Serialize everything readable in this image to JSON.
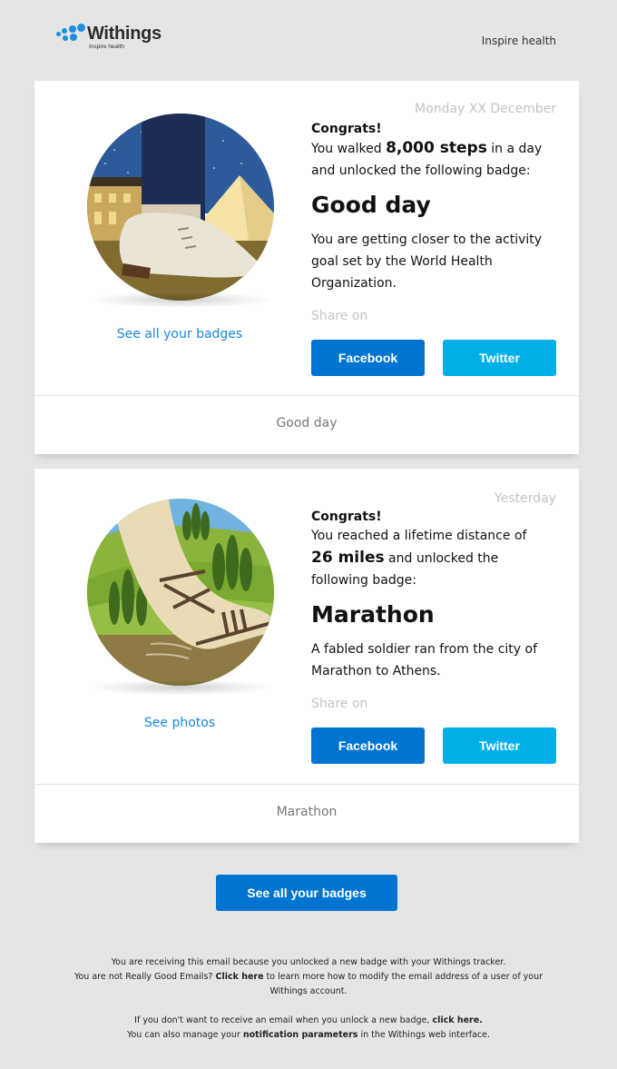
{
  "header": {
    "logo_name": "Withings",
    "logo_tagline": "Inspire health",
    "tagline": "Inspire health",
    "brand_color": "#1a8fe0"
  },
  "cards": [
    {
      "date": "Monday XX December",
      "congrats": "Congrats!",
      "line1_pre": "You walked ",
      "line1_bold": "8,000 steps",
      "line1_post": " in a day",
      "line2": "and unlocked the following badge:",
      "badge_name": "Good day",
      "description": "You are getting closer to the activity goal set by the World Health Organization.",
      "share_label": "Share on",
      "facebook_label": "Facebook",
      "twitter_label": "Twitter",
      "link_label": "See all your badges",
      "footer_label": "Good day",
      "image": "badge-good-day-shoe-louvre"
    },
    {
      "date": "Yesterday",
      "congrats": "Congrats!",
      "line1": "You reached a lifetime distance of",
      "line2_bold": "26 miles",
      "line2_post": " and unlocked the",
      "line3": "following badge:",
      "badge_name": "Marathon",
      "description": "A fabled soldier ran from the city of Marathon to Athens.",
      "share_label": "Share on",
      "facebook_label": "Facebook",
      "twitter_label": "Twitter",
      "link_label": "See photos",
      "footer_label": "Marathon",
      "image": "badge-marathon-sandal-hills"
    }
  ],
  "cta": {
    "label": "See all your badges"
  },
  "fineprint": {
    "p1_line1": "You are receiving this email because you unlocked a new badge with your Withings tracker.",
    "p1_line2_pre": "You are not Really Good Emails? ",
    "p1_line2_link": "Click here",
    "p1_line2_post": " to learn more how to modify the email address of a user of your Withings account.",
    "p2_line1_pre": "If you don't want to receive an email when you unlock a new badge, ",
    "p2_line1_link": "click here.",
    "p2_line2_pre": "You can also manage your ",
    "p2_line2_link": "notification parameters",
    "p2_line2_post": " in the Withings web interface."
  },
  "colors": {
    "facebook": "#0074d1",
    "twitter": "#00aee8",
    "link": "#1a87e0",
    "muted": "#c4c4c4"
  }
}
